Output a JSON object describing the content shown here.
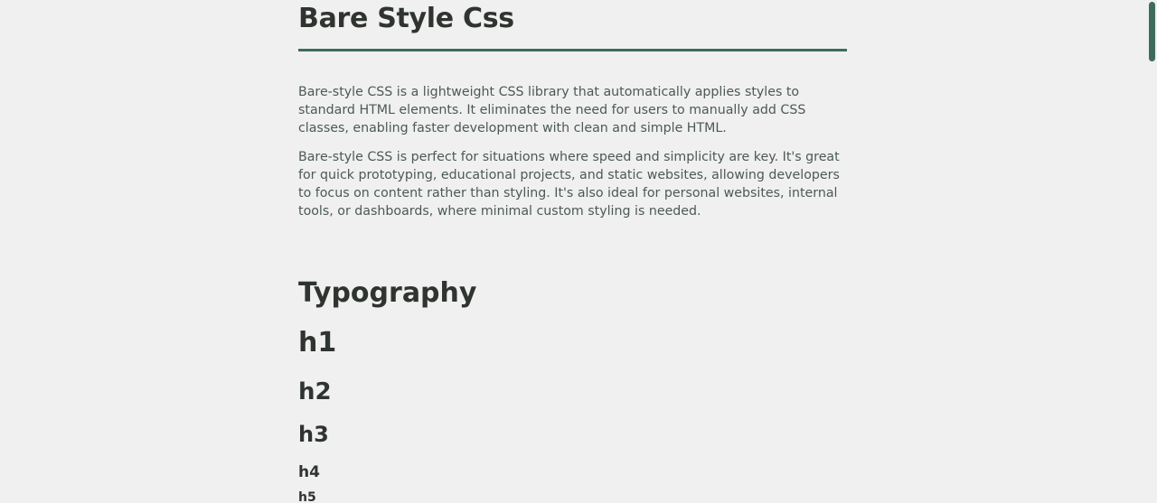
{
  "header": {
    "title": "Bare Style Css"
  },
  "intro": {
    "paragraphs": [
      "Bare-style CSS is a lightweight CSS library that automatically applies styles to standard HTML elements. It eliminates the need for users to manually add CSS classes, enabling faster development with clean and simple HTML.",
      "Bare-style CSS is perfect for situations where speed and simplicity are key. It's great for quick prototyping, educational projects, and static websites, allowing developers to focus on content rather than styling. It's also ideal for personal websites, internal tools, or dashboards, where minimal custom styling is needed."
    ]
  },
  "typography": {
    "heading": "Typography",
    "samples": [
      "h1",
      "h2",
      "h3",
      "h4",
      "h5"
    ]
  },
  "colors": {
    "background": "#f0f0f0",
    "text": "#2f3430",
    "body_text": "#4c5a52",
    "accent": "#3f6b5e"
  }
}
